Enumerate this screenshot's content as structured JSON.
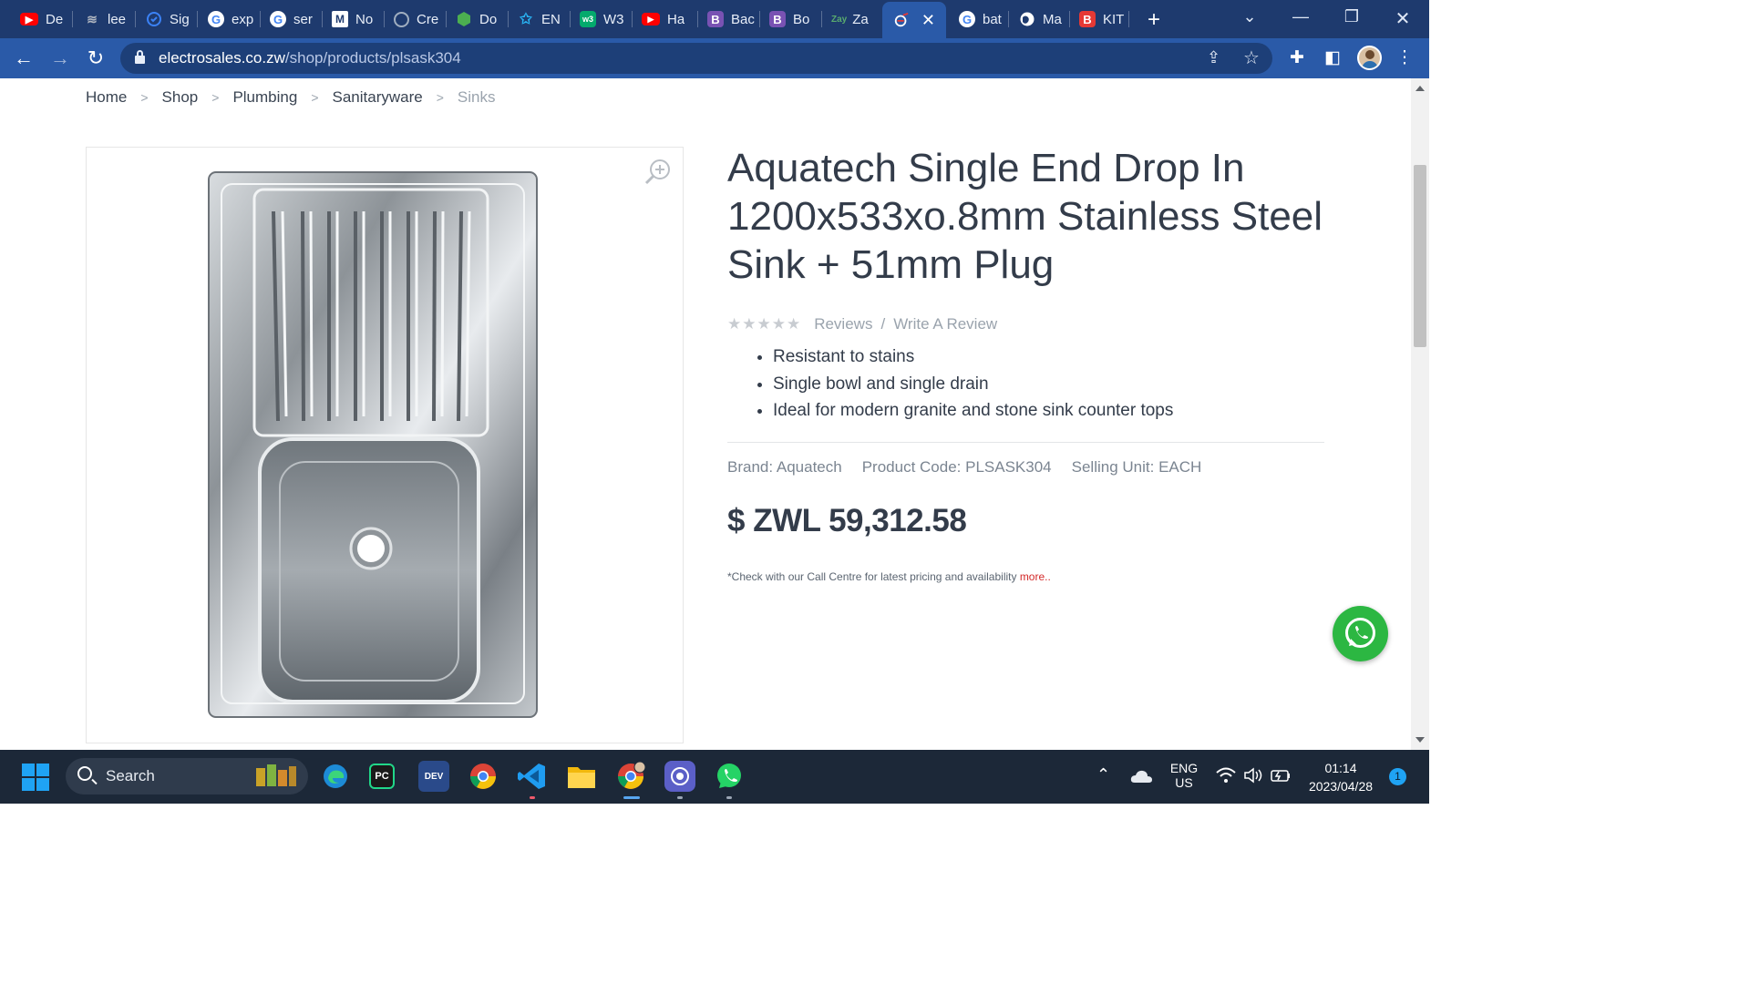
{
  "browser": {
    "tabs": [
      {
        "label": "De",
        "icon": "youtube-icon",
        "color": "#ff0000"
      },
      {
        "label": "lee",
        "icon": "stack-icon",
        "color": "#8a8f99"
      },
      {
        "label": "Sig",
        "icon": "shield-icon",
        "color": "#3b82f6"
      },
      {
        "label": "exp",
        "icon": "google-icon",
        "color": "#ffffff"
      },
      {
        "label": "ser",
        "icon": "google-icon",
        "color": "#ffffff"
      },
      {
        "label": "No",
        "icon": "gmail-icon",
        "color": "#ffffff"
      },
      {
        "label": "Cre",
        "icon": "openai-icon",
        "color": "#a0aec0"
      },
      {
        "label": "Do",
        "icon": "cube-icon",
        "color": "#4caf50"
      },
      {
        "label": "EN",
        "icon": "star-logo-icon",
        "color": "#29b6f6"
      },
      {
        "label": "W3",
        "icon": "w3schools-icon",
        "color": "#04aa6d"
      },
      {
        "label": "Ha",
        "icon": "youtube-icon",
        "color": "#ff0000"
      },
      {
        "label": "Bac",
        "icon": "bootstrap-icon",
        "color": "#7952b3"
      },
      {
        "label": "Bo",
        "icon": "bootstrap-icon",
        "color": "#7952b3"
      },
      {
        "label": "Za",
        "icon": "zay-icon",
        "color": "#59ab6e"
      },
      {
        "label": "",
        "icon": "electrosales-icon",
        "color": "#ffffff",
        "active": true
      },
      {
        "label": "bat",
        "icon": "google-icon",
        "color": "#ffffff"
      },
      {
        "label": "Ma",
        "icon": "globe-icon",
        "color": "#ffffff"
      },
      {
        "label": "KIT",
        "icon": "bold-b-icon",
        "color": "#e53935"
      }
    ],
    "zay_icon_text": "Zay",
    "bootstrap_letter": "B",
    "kit_letter": "B",
    "new_tab": "+",
    "close_tab": "✕",
    "url_domain": "electrosales.co.zw",
    "url_path": "/shop/products/plsask304"
  },
  "breadcrumb": [
    "Home",
    "Shop",
    "Plumbing",
    "Sanitaryware",
    "Sinks"
  ],
  "product": {
    "title": "Aquatech Single End Drop In 1200x533xo.8mm Stainless Steel Sink + 51mm Plug",
    "stars": "★★★★★",
    "rating_value": 0,
    "reviews_label": "Reviews",
    "write_review_label": "Write A Review",
    "rating_sep": "/",
    "features": [
      "Resistant to stains",
      "Single bowl and single drain",
      "Ideal for modern granite and stone sink counter tops"
    ],
    "brand": "Brand: Aquatech",
    "code": "Product Code: PLSASK304",
    "unit": "Selling Unit: EACH",
    "price": "$ ZWL 59,312.58",
    "price_note": "*Check with our Call Centre for latest pricing and availability ",
    "more_link": "more.."
  },
  "taskbar": {
    "search_label": "Search",
    "apps": [
      "edge-icon",
      "pycharm-icon",
      "devcpp-icon",
      "chrome-icon",
      "vscode-icon",
      "file-explorer-icon",
      "chrome-profile-icon",
      "tor-icon",
      "whatsapp-icon"
    ],
    "pycharm_text": "PC",
    "devcpp_text": "DEV",
    "lang_top": "ENG",
    "lang_bottom": "US",
    "time": "01:14",
    "date": "2023/04/28",
    "notifications": "1"
  },
  "colors": {
    "tabstrip": "#1e3a6e",
    "toolbar": "#2a5aa8",
    "whatsapp": "#2cb742",
    "more_link": "#d42a2a"
  }
}
